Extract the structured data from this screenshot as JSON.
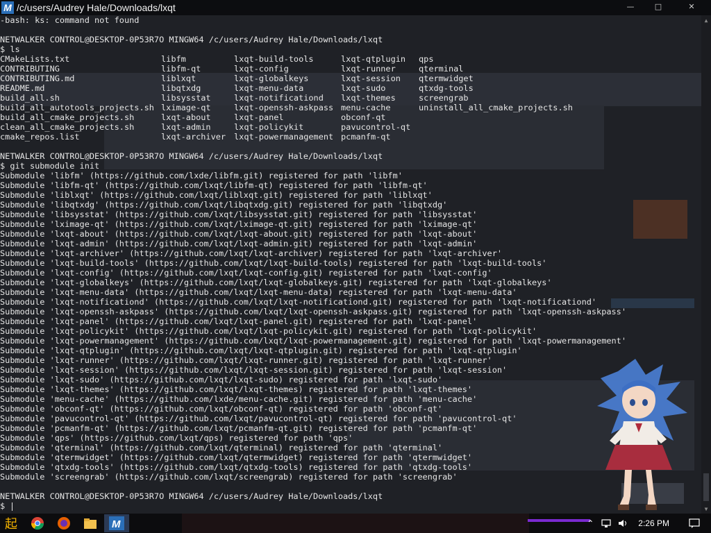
{
  "window": {
    "title": "/c/users/Audrey Hale/Downloads/lxqt",
    "app_icon_letter": "M",
    "controls": {
      "minimize": "—",
      "maximize": "□",
      "close": "✕"
    }
  },
  "terminal": {
    "pre_lines": [
      "-bash: ks: command not found",
      ""
    ],
    "prompt1": {
      "user": "NETWALKER CONTROL@DESKTOP-0P53R7O MINGW64",
      "path": "/c/users/Audrey Hale/Downloads/lxqt"
    },
    "cmd1": "$ ls",
    "ls_rows": [
      [
        "CMakeLists.txt",
        "libfm",
        "lxqt-build-tools",
        "lxqt-qtplugin",
        "qps"
      ],
      [
        "CONTRIBUTING",
        "libfm-qt",
        "lxqt-config",
        "lxqt-runner",
        "qterminal"
      ],
      [
        "CONTRIBUTING.md",
        "liblxqt",
        "lxqt-globalkeys",
        "lxqt-session",
        "qtermwidget"
      ],
      [
        "README.md",
        "libqtxdg",
        "lxqt-menu-data",
        "lxqt-sudo",
        "qtxdg-tools"
      ],
      [
        "build_all.sh",
        "libsysstat",
        "lxqt-notificationd",
        "lxqt-themes",
        "screengrab"
      ],
      [
        "build_all_autotools_projects.sh",
        "lximage-qt",
        "lxqt-openssh-askpass",
        "menu-cache",
        "uninstall_all_cmake_projects.sh"
      ],
      [
        "build_all_cmake_projects.sh",
        "lxqt-about",
        "lxqt-panel",
        "obconf-qt",
        ""
      ],
      [
        "clean_all_cmake_projects.sh",
        "lxqt-admin",
        "lxqt-policykit",
        "pavucontrol-qt",
        ""
      ],
      [
        "cmake_repos.list",
        "lxqt-archiver",
        "lxqt-powermanagement",
        "pcmanfm-qt",
        ""
      ]
    ],
    "prompt2": {
      "user": "NETWALKER CONTROL@DESKTOP-0P53R7O MINGW64",
      "path": "/c/users/Audrey Hale/Downloads/lxqt"
    },
    "cmd2": "$ git submodule init",
    "output_lines": [
      "Submodule 'libfm' (https://github.com/lxde/libfm.git) registered for path 'libfm'",
      "Submodule 'libfm-qt' (https://github.com/lxqt/libfm-qt) registered for path 'libfm-qt'",
      "Submodule 'liblxqt' (https://github.com/lxqt/liblxqt.git) registered for path 'liblxqt'",
      "Submodule 'libqtxdg' (https://github.com/lxqt/libqtxdg.git) registered for path 'libqtxdg'",
      "Submodule 'libsysstat' (https://github.com/lxqt/libsysstat.git) registered for path 'libsysstat'",
      "Submodule 'lximage-qt' (https://github.com/lxqt/lximage-qt.git) registered for path 'lximage-qt'",
      "Submodule 'lxqt-about' (https://github.com/lxqt/lxqt-about.git) registered for path 'lxqt-about'",
      "Submodule 'lxqt-admin' (https://github.com/lxqt/lxqt-admin.git) registered for path 'lxqt-admin'",
      "Submodule 'lxqt-archiver' (https://github.com/lxqt/lxqt-archiver) registered for path 'lxqt-archiver'",
      "Submodule 'lxqt-build-tools' (https://github.com/lxqt/lxqt-build-tools) registered for path 'lxqt-build-tools'",
      "Submodule 'lxqt-config' (https://github.com/lxqt/lxqt-config.git) registered for path 'lxqt-config'",
      "Submodule 'lxqt-globalkeys' (https://github.com/lxqt/lxqt-globalkeys.git) registered for path 'lxqt-globalkeys'",
      "Submodule 'lxqt-menu-data' (https://github.com/lxqt/lxqt-menu-data) registered for path 'lxqt-menu-data'",
      "Submodule 'lxqt-notificationd' (https://github.com/lxqt/lxqt-notificationd.git) registered for path 'lxqt-notificationd'",
      "Submodule 'lxqt-openssh-askpass' (https://github.com/lxqt/lxqt-openssh-askpass.git) registered for path 'lxqt-openssh-askpass'",
      "Submodule 'lxqt-panel' (https://github.com/lxqt/lxqt-panel.git) registered for path 'lxqt-panel'",
      "Submodule 'lxqt-policykit' (https://github.com/lxqt/lxqt-policykit.git) registered for path 'lxqt-policykit'",
      "Submodule 'lxqt-powermanagement' (https://github.com/lxqt/lxqt-powermanagement.git) registered for path 'lxqt-powermanagement'",
      "Submodule 'lxqt-qtplugin' (https://github.com/lxqt/lxqt-qtplugin.git) registered for path 'lxqt-qtplugin'",
      "Submodule 'lxqt-runner' (https://github.com/lxqt/lxqt-runner.git) registered for path 'lxqt-runner'",
      "Submodule 'lxqt-session' (https://github.com/lxqt/lxqt-session.git) registered for path 'lxqt-session'",
      "Submodule 'lxqt-sudo' (https://github.com/lxqt/lxqt-sudo) registered for path 'lxqt-sudo'",
      "Submodule 'lxqt-themes' (https://github.com/lxqt/lxqt-themes) registered for path 'lxqt-themes'",
      "Submodule 'menu-cache' (https://github.com/lxde/menu-cache.git) registered for path 'menu-cache'",
      "Submodule 'obconf-qt' (https://github.com/lxqt/obconf-qt) registered for path 'obconf-qt'",
      "Submodule 'pavucontrol-qt' (https://github.com/lxqt/pavucontrol-qt) registered for path 'pavucontrol-qt'",
      "Submodule 'pcmanfm-qt' (https://github.com/lxqt/pcmanfm-qt.git) registered for path 'pcmanfm-qt'",
      "Submodule 'qps' (https://github.com/lxqt/qps) registered for path 'qps'",
      "Submodule 'qterminal' (https://github.com/lxqt/qterminal) registered for path 'qterminal'",
      "Submodule 'qtermwidget' (https://github.com/lxqt/qtermwidget) registered for path 'qtermwidget'",
      "Submodule 'qtxdg-tools' (https://github.com/lxqt/qtxdg-tools) registered for path 'qtxdg-tools'",
      "Submodule 'screengrab' (https://github.com/lxqt/screengrab) registered for path 'screengrab'"
    ],
    "prompt3": {
      "user": "NETWALKER CONTROL@DESKTOP-0P53R7O MINGW64",
      "path": "/c/users/Audrey Hale/Downloads/lxqt"
    },
    "cmd3": "$ "
  },
  "taskbar": {
    "pinned": [
      "start-icon",
      "chrome-icon",
      "firefox-icon",
      "file-explorer-icon",
      "mintty-icon"
    ],
    "clock": "2:26 PM"
  },
  "colors": {
    "terminal_bg": "#1f2126",
    "text": "#e6e6e6",
    "taskbar_bg": "#0c0c0e",
    "accent_purple": "#7a2ad0"
  }
}
